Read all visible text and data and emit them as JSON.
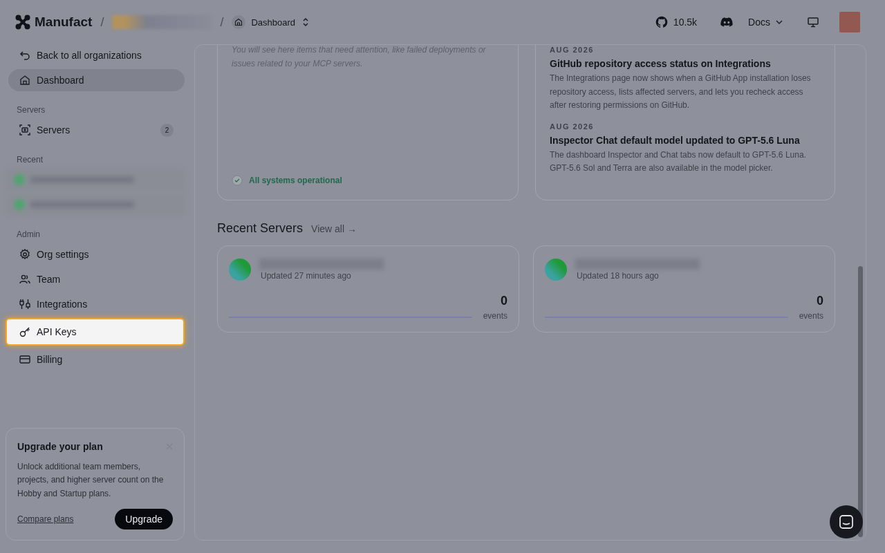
{
  "topbar": {
    "brand": "Manufact",
    "breadcrumbs": [
      {
        "kind": "org",
        "separator": "/"
      },
      {
        "kind": "page",
        "separator": "/",
        "label": "Dashboard"
      }
    ],
    "github_stars": "10.5k",
    "docs": "Docs"
  },
  "sidebar": {
    "back": "Back to all organizations",
    "dashboard": {
      "label": "Dashboard",
      "selected": true
    },
    "sections": [
      {
        "title": "Servers",
        "items": [
          {
            "kind": "nav",
            "label": "Servers",
            "badge": "2",
            "selected": false,
            "spotlight": false
          }
        ]
      },
      {
        "title": "Recent",
        "items": [
          {
            "kind": "redacted"
          },
          {
            "kind": "redacted"
          }
        ]
      },
      {
        "title": "Admin",
        "items": [
          {
            "kind": "nav",
            "label": "Org settings",
            "selected": false,
            "spotlight": false
          },
          {
            "kind": "nav",
            "label": "Team",
            "selected": false,
            "spotlight": false
          },
          {
            "kind": "nav",
            "label": "Integrations",
            "selected": false,
            "spotlight": false
          },
          {
            "kind": "nav",
            "label": "API Keys",
            "selected": false,
            "spotlight": true
          },
          {
            "kind": "nav",
            "label": "Billing",
            "selected": false,
            "spotlight": false
          }
        ]
      }
    ],
    "upgrade": {
      "title": "Upgrade your plan",
      "text": "Unlock additional team members, projects, and higher server count on the Hobby and Startup plans.",
      "link": "Compare plans",
      "button": "Upgrade"
    }
  },
  "attention": {
    "text": "You will see here items that need attention, like failed deployments or issues related to your MCP servers.",
    "status": "All systems operational"
  },
  "updates": [
    {
      "date": "AUG 2026",
      "title": "GitHub repository access status on Integrations",
      "text": "The Integrations page now shows when a GitHub App installation loses repository access, lists affected servers, and lets you recheck access after restoring permissions on GitHub."
    },
    {
      "date": "AUG 2026",
      "title": "Inspector Chat default model updated to GPT-5.6 Luna",
      "text": "The dashboard Inspector and Chat tabs now default to GPT-5.6 Luna. GPT-5.6 Sol and Terra are also available in the model picker."
    }
  ],
  "recent_servers": {
    "title": "Recent Servers",
    "view_all": "View all →",
    "servers": [
      {
        "updated": "Updated 27 minutes ago",
        "count": "0",
        "unit": "events"
      },
      {
        "updated": "Updated 18 hours ago",
        "count": "0",
        "unit": "events"
      }
    ]
  }
}
